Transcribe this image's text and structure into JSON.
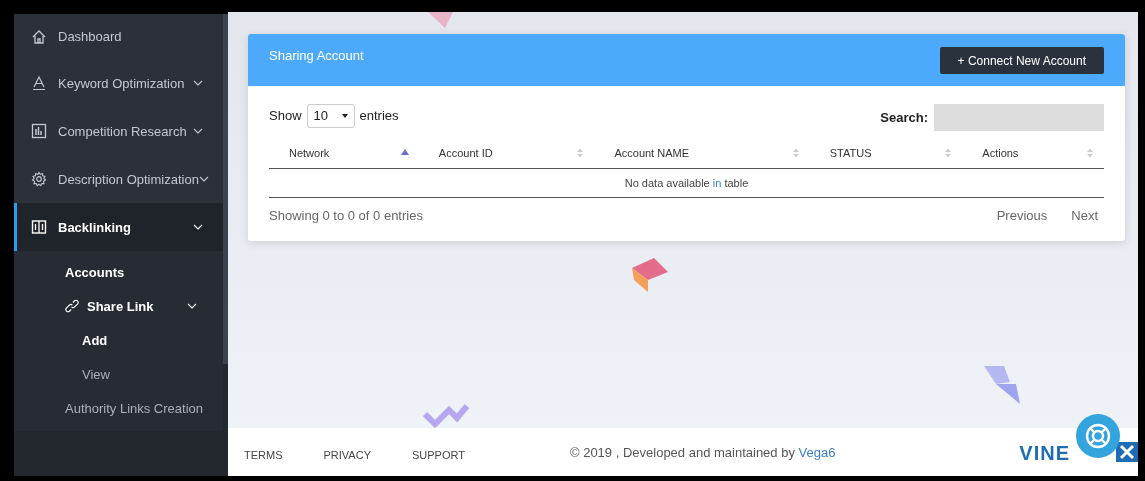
{
  "sidebar": {
    "items": [
      {
        "label": "Dashboard",
        "selected": false
      },
      {
        "label": "Keyword Optimization",
        "selected": false
      },
      {
        "label": "Competition Research",
        "selected": false
      },
      {
        "label": "Description Optimization",
        "selected": false
      },
      {
        "label": "Backlinking",
        "selected": true,
        "children": [
          {
            "label": "Accounts",
            "selected": true
          },
          {
            "label": "Share Link",
            "selected": true,
            "children": [
              {
                "label": "Add",
                "selected": true
              },
              {
                "label": "View",
                "selected": false
              }
            ]
          },
          {
            "label": "Authority Links Creation",
            "selected": false
          }
        ]
      }
    ]
  },
  "card": {
    "title": "Sharing Account",
    "button": "+ Connect New Account",
    "length": {
      "prefix": "Show",
      "value": "10",
      "suffix": "entries"
    },
    "search": {
      "label": "Search:"
    },
    "table": {
      "columns": [
        {
          "label": "Network",
          "sorted": true
        },
        {
          "label": "Account ID",
          "sorted": false
        },
        {
          "label": "Account NAME",
          "sorted": false
        },
        {
          "label": "STATUS",
          "sorted": false
        },
        {
          "label": "Actions",
          "sorted": false
        }
      ],
      "empty": {
        "before": "No data available ",
        "link": "in",
        "after": " table"
      }
    },
    "info": "Showing 0 to 0 of 0 entries",
    "pagination": [
      "Previous",
      "Next"
    ]
  },
  "footer": {
    "links": [
      "TERMS",
      "PRIVACY",
      "SUPPORT"
    ],
    "copyright": "© 2019 , Developed and maintained by ",
    "company": "Vega6",
    "logo": "VINE"
  }
}
